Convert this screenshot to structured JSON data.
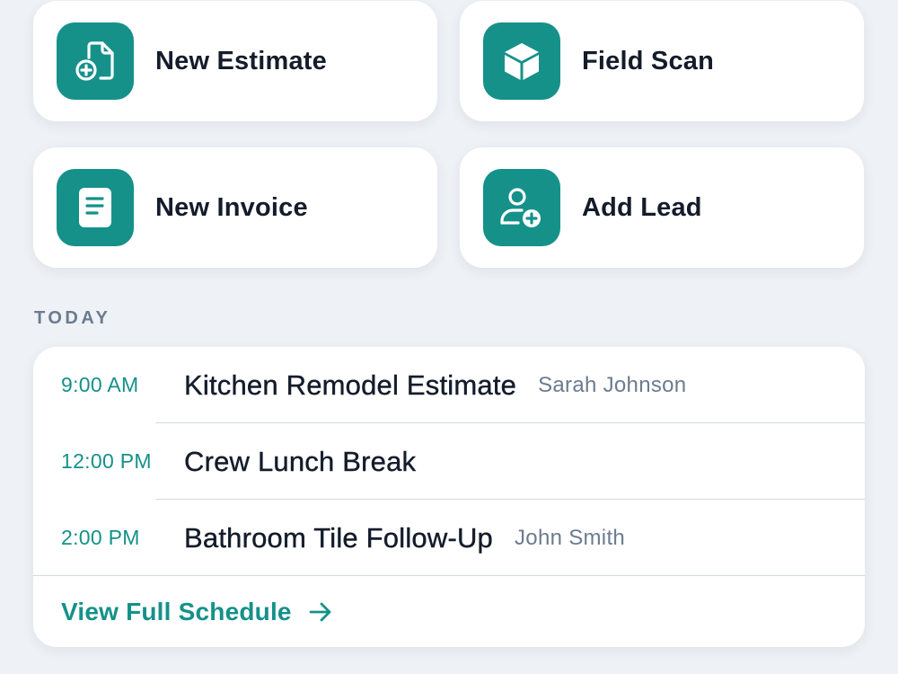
{
  "quick_actions": [
    {
      "label": "New Estimate",
      "icon": "document-plus-icon"
    },
    {
      "label": "Field Scan",
      "icon": "cube-icon"
    },
    {
      "label": "New Invoice",
      "icon": "invoice-document-icon"
    },
    {
      "label": "Add Lead",
      "icon": "user-plus-icon"
    }
  ],
  "today": {
    "section_label": "TODAY",
    "events": [
      {
        "time": "9:00 AM",
        "title": "Kitchen Remodel Estimate",
        "person": "Sarah Johnson"
      },
      {
        "time": "12:00 PM",
        "title": "Crew Lunch Break",
        "person": ""
      },
      {
        "time": "2:00 PM",
        "title": "Bathroom Tile Follow-Up",
        "person": "John Smith"
      }
    ],
    "view_all_label": "View Full Schedule"
  },
  "colors": {
    "accent": "#15918a",
    "background": "#eef1f5",
    "text_primary": "#141c2b",
    "text_secondary": "#6c7b8f"
  }
}
